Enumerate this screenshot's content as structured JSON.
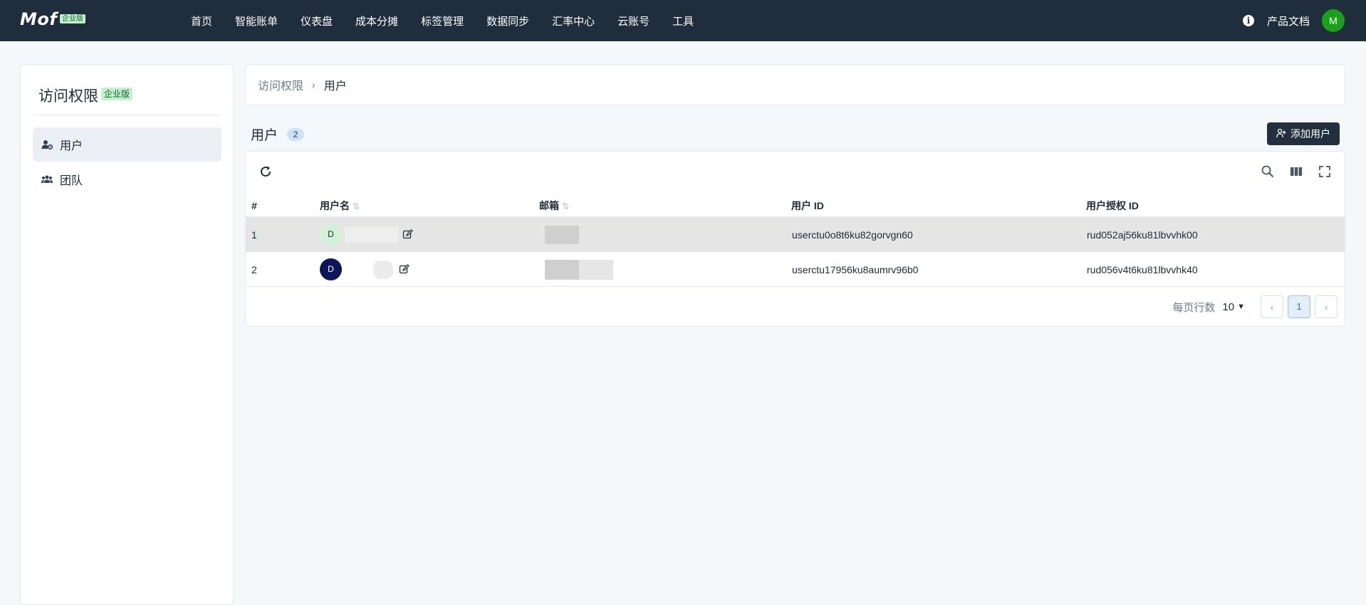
{
  "app": {
    "logo": "Mof",
    "edition_badge": "企业版"
  },
  "nav": {
    "items": [
      "首页",
      "智能账单",
      "仪表盘",
      "成本分摊",
      "标签管理",
      "数据同步",
      "汇率中心",
      "云账号",
      "工具"
    ],
    "docs": "产品文档",
    "user_initial": "M",
    "info_icon": "info-icon"
  },
  "sidebar": {
    "title": "访问权限",
    "badge": "企业版",
    "items": [
      {
        "label": "用户",
        "icon": "user-gear-icon",
        "active": true
      },
      {
        "label": "团队",
        "icon": "team-icon",
        "active": false
      }
    ]
  },
  "breadcrumb": {
    "parent": "访问权限",
    "separator": "›",
    "current": "用户"
  },
  "page": {
    "title": "用户",
    "count": "2",
    "add_button": "添加用户"
  },
  "table": {
    "columns": [
      "#",
      "用户名",
      "邮箱",
      "用户 ID",
      "用户授权 ID"
    ],
    "rows": [
      {
        "index": "1",
        "avatar": "D",
        "user_id": "userctu0o8t6ku82gorvgn60",
        "auth_id": "rud052aj56ku81lbvvhk00"
      },
      {
        "index": "2",
        "avatar": "D",
        "user_id": "userctu17956ku8aumrv96b0",
        "auth_id": "rud056v4t6ku81lbvvhk40"
      }
    ]
  },
  "pagination": {
    "rows_per_page_label": "每页行数",
    "rows_per_page": "10",
    "current_page": "1"
  },
  "colors": {
    "topbar": "#1f2d3d",
    "accent_green": "#19a11b",
    "add_button": "#222f3e"
  }
}
